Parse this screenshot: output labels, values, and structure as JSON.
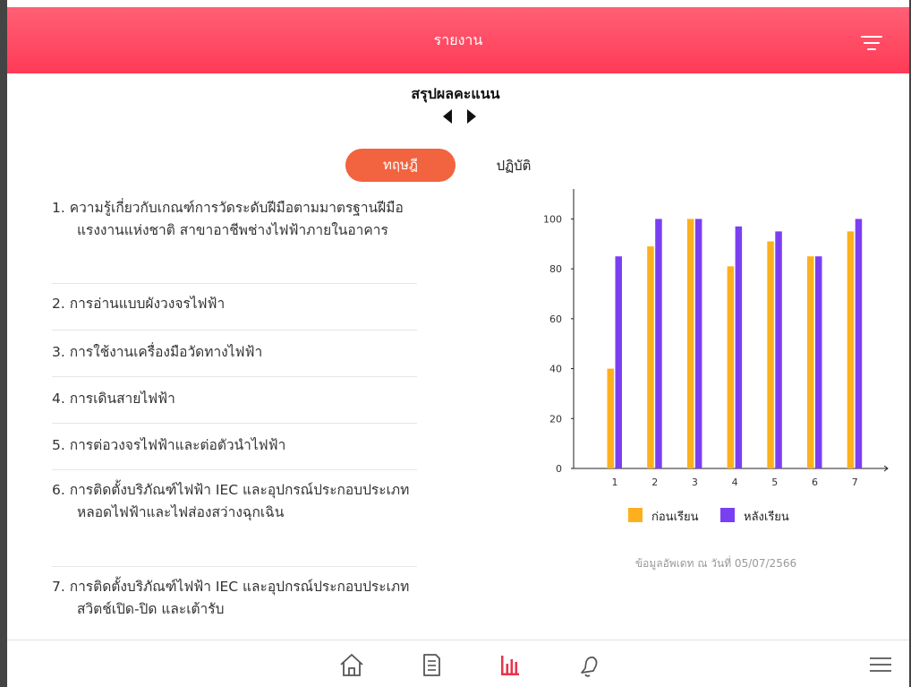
{
  "header": {
    "title": "รายงาน"
  },
  "page": {
    "title": "สรุปผลคะแนน"
  },
  "tabs": {
    "active": "ทฤษฎี",
    "inactive": "ปฏิบัติ"
  },
  "topics": [
    "1. ความรู้เกี่ยวกับเกณฑ์การวัดระดับฝีมือตามมาตรฐานฝีมือแรงงานแห่งชาติ สาขาอาชีพช่างไฟฟ้าภายในอาคาร",
    "2. การอ่านแบบผังวงจรไฟฟ้า",
    "3. การใช้งานเครื่องมือวัดทางไฟฟ้า",
    "4. การเดินสายไฟฟ้า",
    "5. การต่อวงจรไฟฟ้าและต่อตัวนำไฟฟ้า",
    "6. การติดตั้งบริภัณฑ์ไฟฟ้า IEC และอุปกรณ์ประกอบประเภทหลอดไฟฟ้าและไฟส่องสว่างฉุกเฉิน",
    "7. การติดตั้งบริภัณฑ์ไฟฟ้า IEC และอุปกรณ์ประกอบประเภทสวิตช์เปิด-ปิด และเต้ารับ"
  ],
  "chart_data": {
    "type": "bar",
    "categories": [
      "1",
      "2",
      "3",
      "4",
      "5",
      "6",
      "7"
    ],
    "series": [
      {
        "name": "ก่อนเรียน",
        "values": [
          40,
          89,
          100,
          81,
          91,
          85,
          95
        ],
        "color": "#fdb01d"
      },
      {
        "name": "หลังเรียน",
        "values": [
          85,
          100,
          100,
          97,
          95,
          85,
          100
        ],
        "color": "#7b3ff2"
      }
    ],
    "yticks": [
      0,
      20,
      40,
      60,
      80,
      100
    ],
    "ylim": [
      0,
      112
    ],
    "grid": false,
    "legend": "bottom"
  },
  "update_text": "ข้อมูลอัพเดท ณ วันที่ 05/07/2566",
  "colors": {
    "header": "#ff4560",
    "accent": "#f2633f",
    "nav_active": "#e8344e",
    "nav_icon": "#555555"
  },
  "nav": {
    "items": [
      "home-icon",
      "document-icon",
      "chart-icon",
      "bell-icon",
      "menu-icon"
    ],
    "active": "chart-icon"
  }
}
